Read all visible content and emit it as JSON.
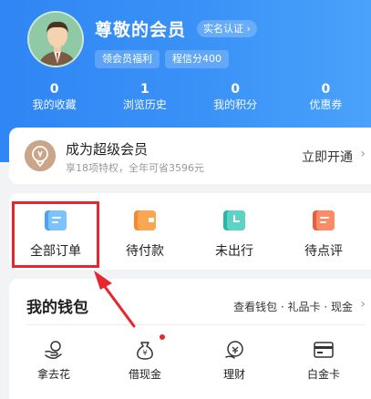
{
  "profile": {
    "username": "尊敬的会员",
    "verify_tag": "实名认证",
    "tags": [
      "领会员福利",
      "程信分400"
    ]
  },
  "stats": [
    {
      "value": "0",
      "label": "我的收藏"
    },
    {
      "value": "1",
      "label": "浏览历史"
    },
    {
      "value": "0",
      "label": "我的积分"
    },
    {
      "value": "0",
      "label": "优惠券"
    }
  ],
  "vip": {
    "title": "成为超级会员",
    "subtitle": "享18项特权，全年可省3596元",
    "link": "立即开通"
  },
  "orders": [
    {
      "label": "全部订单",
      "icon": "all-orders-icon"
    },
    {
      "label": "待付款",
      "icon": "wallet-icon"
    },
    {
      "label": "未出行",
      "icon": "clock-icon"
    },
    {
      "label": "待点评",
      "icon": "comment-icon"
    }
  ],
  "wallet": {
    "title": "我的钱包",
    "link": "查看钱包 · 礼品卡 · 现金",
    "items": [
      {
        "label": "拿去花",
        "icon": "hand-coin-icon"
      },
      {
        "label": "借现金",
        "icon": "money-bag-icon"
      },
      {
        "label": "理财",
        "icon": "finance-icon"
      },
      {
        "label": "白金卡",
        "icon": "card-icon"
      }
    ]
  },
  "colors": {
    "header_blue": "#3a92f7",
    "highlight_red": "#e8262e"
  }
}
